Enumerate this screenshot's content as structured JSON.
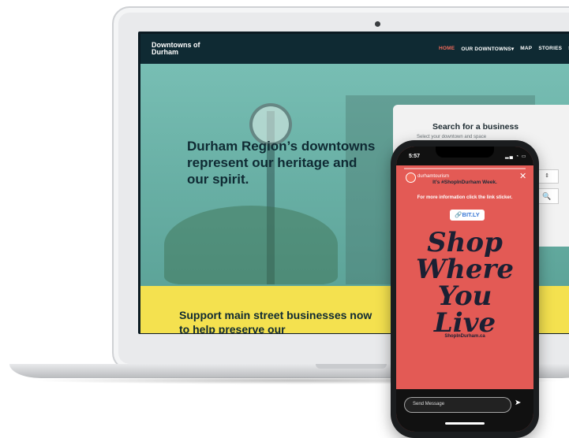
{
  "website": {
    "brand": "Downtowns of Durham",
    "nav": [
      "HOME",
      "OUR DOWNTOWNS▾",
      "MAP",
      "STORIES",
      "SI"
    ],
    "hero_heading": "Durham Region’s downtowns represent our heritage and our spirit.",
    "search": {
      "title": "Search for a business",
      "subtitle": "Select your downtown and space",
      "select_icon": "up-down-arrows-icon",
      "button_icon": "search-icon"
    },
    "cta": "Support main street businesses now to help preserve our"
  },
  "phone": {
    "time": "5:57",
    "status_icons": "signal-wifi-battery-icon",
    "account": "durhamtourism",
    "close_icon": "close-icon",
    "line1": "It’s #ShopInDurham Week.",
    "line2": "For more information click the link sticker.",
    "sticker": "🔗BIT.LY",
    "script_lines": [
      "Shop",
      "Where",
      "You",
      "Live"
    ],
    "url": "ShopInDurham.ca",
    "send_placeholder": "Send Message",
    "send_icon": "send-arrow-icon"
  }
}
